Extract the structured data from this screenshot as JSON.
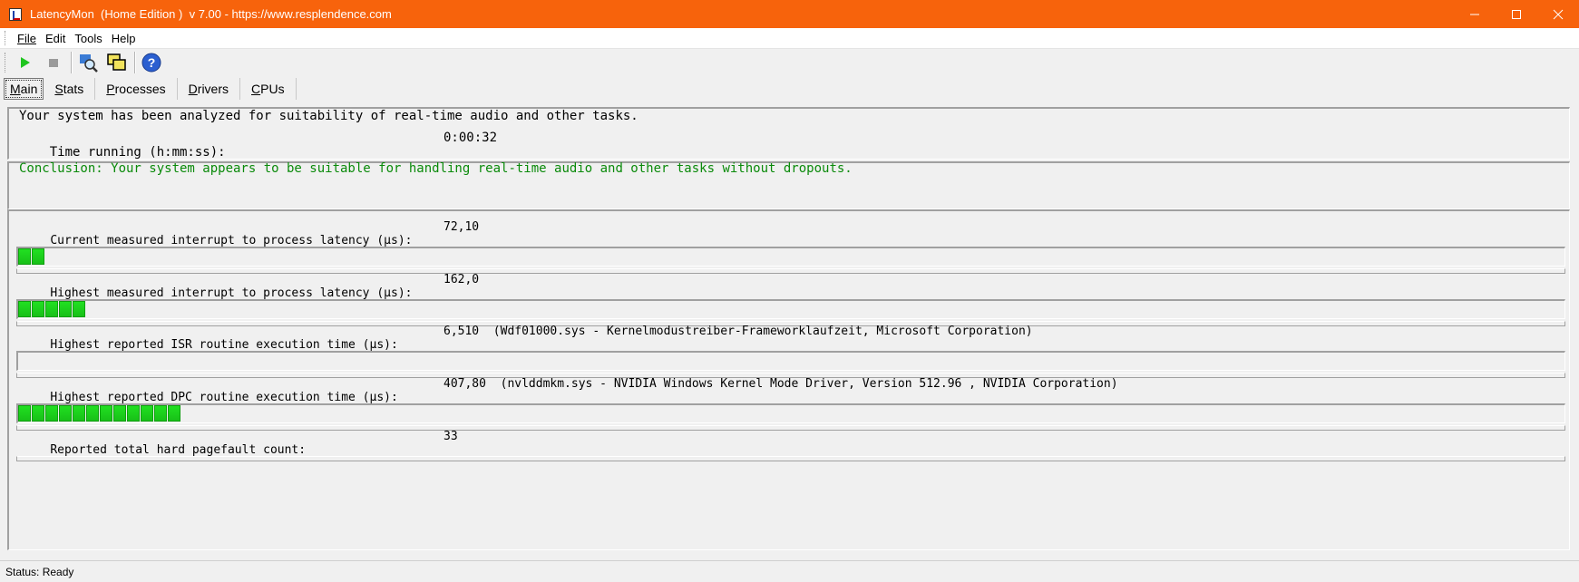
{
  "window": {
    "title": "LatencyMon  (Home Edition )  v 7.00 - https://www.resplendence.com",
    "controls": {
      "minimize": "—",
      "maximize": "☐",
      "close": "✕"
    }
  },
  "menu": [
    {
      "label": "File"
    },
    {
      "label": "Edit"
    },
    {
      "label": "Tools"
    },
    {
      "label": "Help"
    }
  ],
  "toolbar": {
    "buttons": [
      "play-icon",
      "stop-icon",
      "magnifier-icon",
      "windows-icon",
      "help-icon"
    ]
  },
  "tabs": [
    {
      "label": "Main",
      "active": true
    },
    {
      "label": "Stats"
    },
    {
      "label": "Processes"
    },
    {
      "label": "Drivers"
    },
    {
      "label": "CPUs"
    }
  ],
  "summary": {
    "analyzed_text": "Your system has been analyzed for suitability of real-time audio and other tasks.",
    "time_label": "Time running (h:mm:ss):",
    "time_value": "0:00:32",
    "conclusion": "Conclusion: Your system appears to be suitable for handling real-time audio and other tasks without dropouts."
  },
  "metrics": [
    {
      "label": "Current measured interrupt to process latency (µs):",
      "value": "72,10",
      "bar_segments": 2
    },
    {
      "label": "Highest measured interrupt to process latency (µs):",
      "value": "162,0",
      "bar_segments": 5
    },
    {
      "label": "Highest reported ISR routine execution time (µs):",
      "value": "6,510  (Wdf01000.sys - Kernelmodustreiber-Frameworklaufzeit, Microsoft Corporation)",
      "bar_segments": 0
    },
    {
      "label": "Highest reported DPC routine execution time (µs):",
      "value": "407,80  (nvlddmkm.sys - NVIDIA Windows Kernel Mode Driver, Version 512.96 , NVIDIA Corporation)",
      "bar_segments": 12
    },
    {
      "label": "Reported total hard pagefault count:",
      "value": "33",
      "bar_segments": null
    }
  ],
  "status": "Status: Ready",
  "colors": {
    "titlebar": "#f7630c",
    "bar_fill": "#18c018",
    "conclusion": "#0a8a0a"
  }
}
